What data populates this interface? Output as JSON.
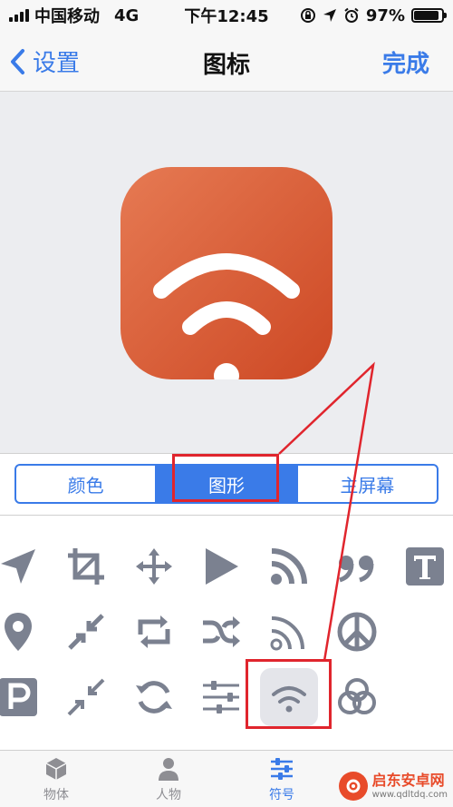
{
  "status_bar": {
    "carrier": "中国移动",
    "network": "4G",
    "time": "下午12:45",
    "battery": "97%",
    "battery_level": 0.97
  },
  "nav": {
    "back_label": "设置",
    "title": "图标",
    "done_label": "完成"
  },
  "preview": {
    "icon_symbol": "wifi-icon",
    "gradient_start": "#e67a53",
    "gradient_end": "#cd4824"
  },
  "segments": [
    {
      "label": "颜色",
      "active": false
    },
    {
      "label": "图形",
      "active": true
    },
    {
      "label": "主屏幕",
      "active": false
    }
  ],
  "symbols": {
    "row1": [
      "location-arrow-icon",
      "crop-icon",
      "move-arrows-icon",
      "play-icon",
      "rss-feed-icon",
      "quote-icon",
      "text-t-icon"
    ],
    "row2": [
      "map-pin-icon",
      "compress-icon",
      "repeat-icon",
      "shuffle-icon",
      "rss-outline-icon",
      "peace-icon"
    ],
    "row3": [
      "parking-icon",
      "collapse-icon",
      "refresh-icon",
      "sliders-icon",
      "wifi-icon",
      "color-circles-icon"
    ],
    "selected": "wifi-icon"
  },
  "tabs": [
    {
      "label": "物体",
      "icon": "cube-icon",
      "active": false
    },
    {
      "label": "人物",
      "icon": "person-icon",
      "active": false
    },
    {
      "label": "符号",
      "icon": "sliders-icon",
      "active": true
    }
  ],
  "watermark": {
    "title": "启东安卓网",
    "url": "www.qdltdq.com"
  },
  "colors": {
    "accent": "#3a7be8",
    "symbol_gray": "#7b8190",
    "annotation_red": "#e0252d"
  }
}
